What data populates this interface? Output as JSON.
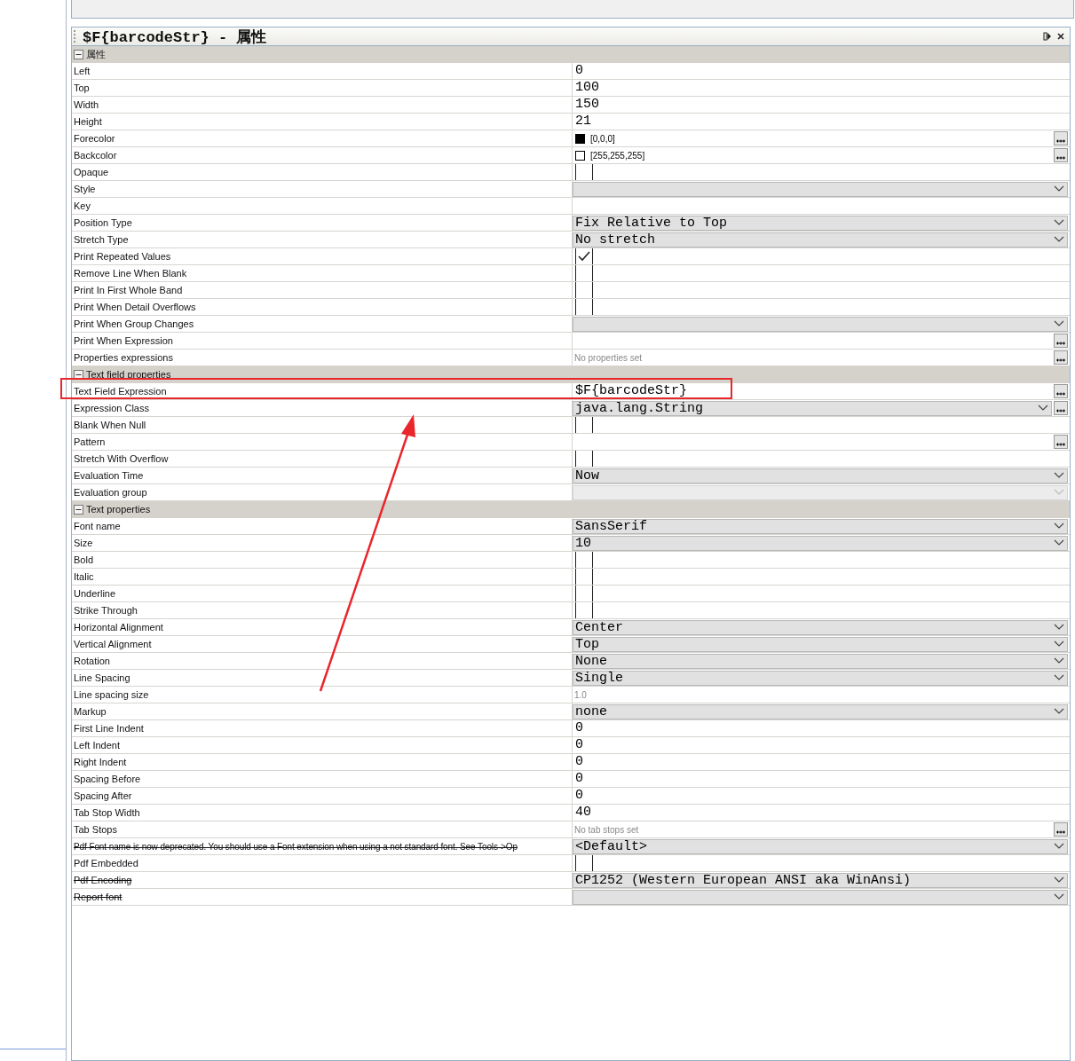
{
  "panel": {
    "title": "$F{barcodeStr} - 属性"
  },
  "sections": [
    {
      "title": "属性",
      "expanded": true,
      "rows": [
        {
          "label": "Left",
          "kind": "text",
          "value": "0"
        },
        {
          "label": "Top",
          "kind": "text",
          "value": "100"
        },
        {
          "label": "Width",
          "kind": "text",
          "value": "150"
        },
        {
          "label": "Height",
          "kind": "text",
          "value": "21"
        },
        {
          "label": "Forecolor",
          "kind": "color",
          "value": "[0,0,0]",
          "color": "#000000",
          "button": true
        },
        {
          "label": "Backcolor",
          "kind": "color",
          "value": "[255,255,255]",
          "color": "#ffffff",
          "button": true
        },
        {
          "label": "Opaque",
          "kind": "checkbox",
          "checked": false
        },
        {
          "label": "Style",
          "kind": "dropdown"
        },
        {
          "label": "Key",
          "kind": "text"
        },
        {
          "label": "Position Type",
          "kind": "dropdown",
          "value": "Fix Relative to Top"
        },
        {
          "label": "Stretch Type",
          "kind": "dropdown",
          "value": "No stretch"
        },
        {
          "label": "Print Repeated Values",
          "kind": "checkbox",
          "checked": true
        },
        {
          "label": "Remove Line When Blank",
          "kind": "checkbox",
          "checked": false
        },
        {
          "label": "Print In First Whole Band",
          "kind": "checkbox",
          "checked": false
        },
        {
          "label": "Print When Detail Overflows",
          "kind": "checkbox",
          "checked": false
        },
        {
          "label": "Print When Group Changes",
          "kind": "dropdown"
        },
        {
          "label": "Print When Expression",
          "kind": "text",
          "button": true
        },
        {
          "label": "Properties expressions",
          "kind": "hint",
          "value": "No properties set",
          "button": true
        }
      ]
    },
    {
      "title": "Text field properties",
      "expanded": true,
      "rows": [
        {
          "label": "Text Field Expression",
          "kind": "text",
          "value": "$F{barcodeStr}",
          "button": true,
          "highlighted": true
        },
        {
          "label": "Expression Class",
          "kind": "dropdown",
          "value": "java.lang.String",
          "button": true
        },
        {
          "label": "Blank When Null",
          "kind": "checkbox",
          "checked": false
        },
        {
          "label": "Pattern",
          "kind": "text",
          "button": true
        },
        {
          "label": "Stretch With Overflow",
          "kind": "checkbox",
          "checked": false
        },
        {
          "label": "Evaluation Time",
          "kind": "dropdown",
          "value": "Now"
        },
        {
          "label": "Evaluation group",
          "kind": "dropdown",
          "disabled": true
        }
      ]
    },
    {
      "title": "Text properties",
      "expanded": true,
      "rows": [
        {
          "label": "Font name",
          "kind": "dropdown",
          "value": "SansSerif"
        },
        {
          "label": "Size",
          "kind": "dropdown",
          "value": "10"
        },
        {
          "label": "Bold",
          "kind": "checkbox",
          "checked": false
        },
        {
          "label": "Italic",
          "kind": "checkbox",
          "checked": false
        },
        {
          "label": "Underline",
          "kind": "checkbox",
          "checked": false
        },
        {
          "label": "Strike Through",
          "kind": "checkbox",
          "checked": false
        },
        {
          "label": "Horizontal Alignment",
          "kind": "dropdown",
          "value": "Center"
        },
        {
          "label": "Vertical Alignment",
          "kind": "dropdown",
          "value": "Top"
        },
        {
          "label": "Rotation",
          "kind": "dropdown",
          "value": "None"
        },
        {
          "label": "Line Spacing",
          "kind": "dropdown",
          "value": "Single"
        },
        {
          "label": "Line spacing size",
          "kind": "hint",
          "value": "1.0"
        },
        {
          "label": "Markup",
          "kind": "dropdown",
          "value": "none"
        },
        {
          "label": "First Line Indent",
          "kind": "text",
          "value": "0"
        },
        {
          "label": "Left Indent",
          "kind": "text",
          "value": "0"
        },
        {
          "label": "Right Indent",
          "kind": "text",
          "value": "0"
        },
        {
          "label": "Spacing Before",
          "kind": "text",
          "value": "0"
        },
        {
          "label": "Spacing After",
          "kind": "text",
          "value": "0"
        },
        {
          "label": "Tab Stop Width",
          "kind": "text",
          "value": "40"
        },
        {
          "label": "Tab Stops",
          "kind": "hint",
          "value": "No tab stops set",
          "button": true
        },
        {
          "label": "Pdf Font name is now deprecated. You should use a Font extension when using a not standard font. See Tools->Op",
          "kind": "dropdown",
          "value": "<Default>",
          "deprecated": true
        },
        {
          "label": "Pdf Embedded",
          "kind": "checkbox",
          "checked": false
        },
        {
          "label": "Pdf Encoding",
          "kind": "dropdown",
          "value": "CP1252 (Western European ANSI aka WinAnsi)",
          "deprecated": true
        },
        {
          "label": "Report font",
          "kind": "dropdown",
          "deprecated": true
        }
      ]
    }
  ]
}
